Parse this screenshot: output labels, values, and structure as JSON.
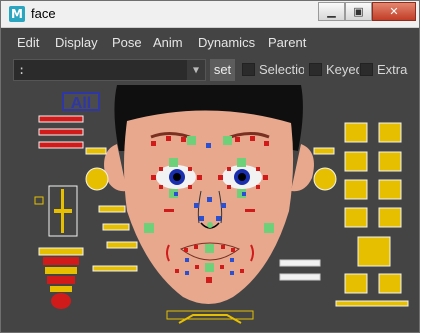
{
  "window": {
    "title": "face",
    "app_icon": "maya-m-icon"
  },
  "window_buttons": {
    "minimize": "▁",
    "maximize": "▣",
    "close": "✕"
  },
  "menubar": [
    "Edit",
    "Display",
    "Pose",
    "Anim",
    "Dynamics",
    "Parent"
  ],
  "toolbar": {
    "combo_value": ":",
    "set_label": "set",
    "checkboxes": [
      {
        "label": "Selectio",
        "checked": false
      },
      {
        "label": "Keyed",
        "checked": false
      },
      {
        "label": "Extra",
        "checked": false
      }
    ]
  },
  "picker": {
    "all_label": "All",
    "colors": {
      "red": "#d11b1b",
      "yellow": "#e6c000",
      "skin": "#e8a88e",
      "hair": "#0f0f0f",
      "green": "#6fd07a",
      "blue": "#2b4fd3",
      "white": "#f2f2f2"
    }
  }
}
